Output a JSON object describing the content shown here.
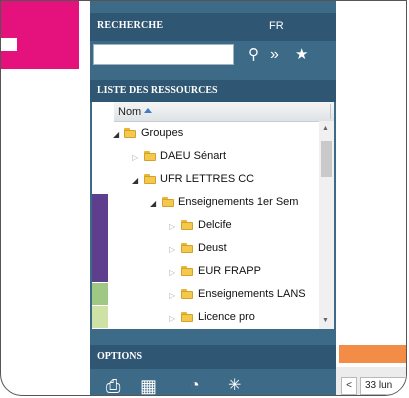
{
  "search": {
    "title": "RECHERCHE",
    "lang": "FR",
    "input_value": "",
    "icons": [
      "search-icon",
      "double-chevron-icon",
      "star-icon"
    ]
  },
  "resources": {
    "title": "LISTE DES RESSOURCES",
    "column_header": "Nom",
    "rows": [
      {
        "label": "Groupes",
        "level": 1,
        "expanded": true
      },
      {
        "label": "DAEU Sénart",
        "level": 2,
        "expanded": false
      },
      {
        "label": "UFR LETTRES CC",
        "level": 2,
        "expanded": true
      },
      {
        "label": "Enseignements 1er Sem",
        "level": 3,
        "expanded": true,
        "color": "#5d3f8e"
      },
      {
        "label": "Delcife",
        "level": 4,
        "expanded": false,
        "color": "#5d3f8e"
      },
      {
        "label": "Deust",
        "level": 4,
        "expanded": false,
        "color": "#5d3f8e"
      },
      {
        "label": "EUR FRAPP",
        "level": 4,
        "expanded": false,
        "color": "#5d3f8e"
      },
      {
        "label": "Enseignements LANS",
        "level": 4,
        "expanded": false,
        "color": "#9ec883"
      },
      {
        "label": "Licence pro",
        "level": 4,
        "expanded": false,
        "color": "#cfe2a6"
      }
    ]
  },
  "options": {
    "title": "OPTIONS",
    "icons": [
      "print-icon",
      "calendar-export-icon",
      "rss-icon",
      "sparkle-icon"
    ]
  },
  "nav": {
    "prev_label": "<",
    "date": "33 lun"
  },
  "colors": {
    "panel": "#3d6a87",
    "header": "#2f5672",
    "accent_pink": "#e5127d",
    "accent_orange": "#f28c46"
  }
}
